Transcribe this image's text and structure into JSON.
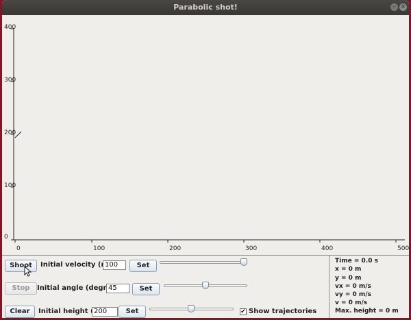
{
  "window": {
    "title": "Parabolic shot!",
    "controls": [
      {
        "icon": "minimize-icon",
        "glyph": "–"
      },
      {
        "icon": "close-icon",
        "glyph": "×"
      }
    ]
  },
  "plot": {
    "y_ticks": [
      "400",
      "300",
      "200",
      "100",
      "0"
    ],
    "x_ticks": [
      "0",
      "100",
      "200",
      "300",
      "400",
      "500"
    ]
  },
  "controls": {
    "shoot_label": "Shoot",
    "stop_label": "Stop",
    "clear_label": "Clear",
    "velocity": {
      "label": "Initial velocity (m/s)",
      "value": "100",
      "set_label": "Set"
    },
    "angle": {
      "label": "Initial angle (degrees)",
      "value": "45",
      "set_label": "Set"
    },
    "height": {
      "label": "Initial height (m)",
      "value": "200",
      "set_label": "Set"
    },
    "show_trajectories": {
      "label": "Show trajectories",
      "checked": true,
      "mark": "✔"
    }
  },
  "stats": {
    "time": "Time = 0.0 s",
    "x": "x = 0 m",
    "y": "y = 0 m",
    "vx": "vx = 0 m/s",
    "vy": "vy = 0 m/s",
    "v": "v = 0 m/s",
    "max_height": "Max. height = 0 m"
  }
}
